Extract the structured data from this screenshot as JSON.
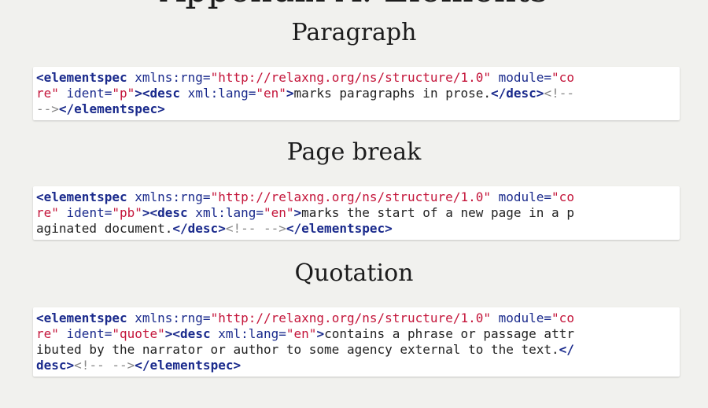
{
  "page": {
    "top_heading_partial": "Appendix A: Elements"
  },
  "sections": [
    {
      "title": "Paragraph",
      "lines": [
        [
          {
            "t": "tag",
            "s": "<elementspec"
          },
          {
            "t": "attr",
            "s": " xmlns:rng="
          },
          {
            "t": "val",
            "s": "\"http://relaxng.org/ns/structure/1.0\""
          },
          {
            "t": "attr",
            "s": " module="
          },
          {
            "t": "val",
            "s": "\"co"
          }
        ],
        [
          {
            "t": "val",
            "s": "re\""
          },
          {
            "t": "attr",
            "s": " ident="
          },
          {
            "t": "val",
            "s": "\"p\""
          },
          {
            "t": "tag",
            "s": "><desc"
          },
          {
            "t": "attr",
            "s": " xml:lang="
          },
          {
            "t": "val",
            "s": "\"en\""
          },
          {
            "t": "tag",
            "s": ">"
          },
          {
            "t": "txt",
            "s": "marks paragraphs in prose."
          },
          {
            "t": "tag",
            "s": "</desc>"
          },
          {
            "t": "cmt",
            "s": "<!--"
          }
        ],
        [
          {
            "t": "cmt",
            "s": "-->"
          },
          {
            "t": "tag",
            "s": "</elementspec>"
          }
        ]
      ]
    },
    {
      "title": "Page break",
      "lines": [
        [
          {
            "t": "tag",
            "s": "<elementspec"
          },
          {
            "t": "attr",
            "s": " xmlns:rng="
          },
          {
            "t": "val",
            "s": "\"http://relaxng.org/ns/structure/1.0\""
          },
          {
            "t": "attr",
            "s": " module="
          },
          {
            "t": "val",
            "s": "\"co"
          }
        ],
        [
          {
            "t": "val",
            "s": "re\""
          },
          {
            "t": "attr",
            "s": " ident="
          },
          {
            "t": "val",
            "s": "\"pb\""
          },
          {
            "t": "tag",
            "s": "><desc"
          },
          {
            "t": "attr",
            "s": " xml:lang="
          },
          {
            "t": "val",
            "s": "\"en\""
          },
          {
            "t": "tag",
            "s": ">"
          },
          {
            "t": "txt",
            "s": "marks the start of a new page in a p"
          }
        ],
        [
          {
            "t": "txt",
            "s": "aginated document."
          },
          {
            "t": "tag",
            "s": "</desc>"
          },
          {
            "t": "cmt",
            "s": "<!-- -->"
          },
          {
            "t": "tag",
            "s": "</elementspec>"
          }
        ]
      ]
    },
    {
      "title": "Quotation",
      "lines": [
        [
          {
            "t": "tag",
            "s": "<elementspec"
          },
          {
            "t": "attr",
            "s": " xmlns:rng="
          },
          {
            "t": "val",
            "s": "\"http://relaxng.org/ns/structure/1.0\""
          },
          {
            "t": "attr",
            "s": " module="
          },
          {
            "t": "val",
            "s": "\"co"
          }
        ],
        [
          {
            "t": "val",
            "s": "re\""
          },
          {
            "t": "attr",
            "s": " ident="
          },
          {
            "t": "val",
            "s": "\"quote\""
          },
          {
            "t": "tag",
            "s": "><desc"
          },
          {
            "t": "attr",
            "s": " xml:lang="
          },
          {
            "t": "val",
            "s": "\"en\""
          },
          {
            "t": "tag",
            "s": ">"
          },
          {
            "t": "txt",
            "s": "contains a phrase or passage attr"
          }
        ],
        [
          {
            "t": "txt",
            "s": "ibuted by the narrator or author to some agency external to the text."
          },
          {
            "t": "tag",
            "s": "</"
          }
        ],
        [
          {
            "t": "tag",
            "s": "desc>"
          },
          {
            "t": "cmt",
            "s": "<!-- -->"
          },
          {
            "t": "tag",
            "s": "</elementspec>"
          }
        ]
      ]
    }
  ]
}
